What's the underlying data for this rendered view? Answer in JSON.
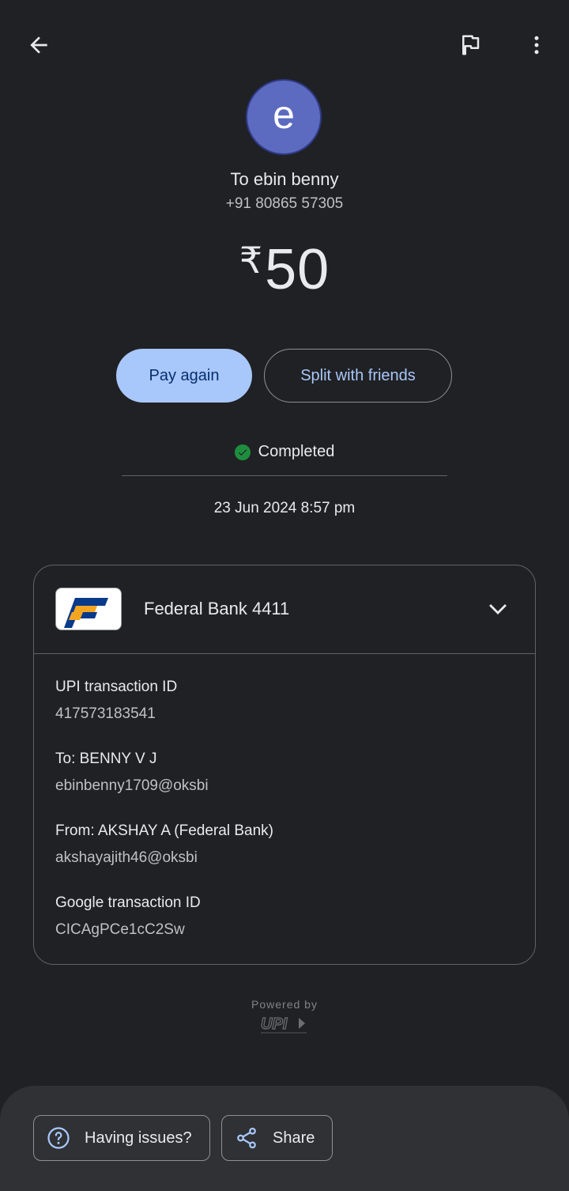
{
  "header": {
    "back_icon": "arrow-back-icon",
    "flag_icon": "flag-icon",
    "more_icon": "more-vert-icon"
  },
  "recipient": {
    "avatar_letter": "e",
    "avatar_color": "#5c6bc0",
    "name_line": "To ebin benny",
    "phone": "+91 80865 57305"
  },
  "payment": {
    "currency_symbol": "₹",
    "amount": "50"
  },
  "actions": {
    "pay_again": "Pay again",
    "split": "Split with friends"
  },
  "status": {
    "text": "Completed",
    "color": "#1e8e3e"
  },
  "datetime": "23 Jun 2024 8:57 pm",
  "account": {
    "bank_name": "Federal Bank 4411"
  },
  "details": [
    {
      "label": "UPI transaction ID",
      "value": "417573183541"
    },
    {
      "label": "To: BENNY  V J",
      "value": "ebinbenny1709@oksbi"
    },
    {
      "label": "From: AKSHAY A (Federal Bank)",
      "value": "akshayajith46@oksbi"
    },
    {
      "label": "Google transaction ID",
      "value": "CICAgPCe1cC2Sw"
    }
  ],
  "footer": {
    "powered_by": "Powered by",
    "logo_text": "UPI"
  },
  "bottom": {
    "issues": "Having issues?",
    "share": "Share"
  }
}
